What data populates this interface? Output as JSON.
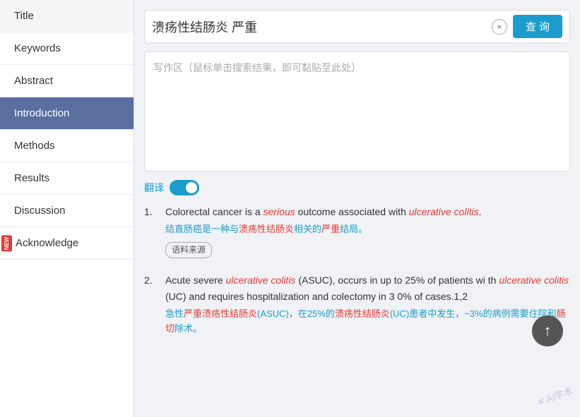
{
  "sidebar": {
    "items": [
      {
        "label": "Title",
        "active": false,
        "new": false
      },
      {
        "label": "Keywords",
        "active": false,
        "new": false
      },
      {
        "label": "Abstract",
        "active": false,
        "new": false
      },
      {
        "label": "Introduction",
        "active": true,
        "new": false
      },
      {
        "label": "Methods",
        "active": false,
        "new": false
      },
      {
        "label": "Results",
        "active": false,
        "new": false
      },
      {
        "label": "Discussion",
        "active": false,
        "new": false
      },
      {
        "label": "Acknowledge",
        "active": false,
        "new": true
      }
    ]
  },
  "search": {
    "value": "溃疡性结肠炎 严重",
    "button_label": "查 询",
    "clear_icon": "×"
  },
  "writing_area": {
    "placeholder": "写作区（鼠标单击搜索结果，即可黏贴至此处）"
  },
  "translate": {
    "label": "翻译"
  },
  "results": [
    {
      "number": "1.",
      "en_text_parts": [
        {
          "text": "Colorectal cancer is a ",
          "type": "normal"
        },
        {
          "text": "serious",
          "type": "italic-red"
        },
        {
          "text": " outcome associated with ",
          "type": "normal"
        },
        {
          "text": "ulcerative colitis",
          "type": "italic-red"
        },
        {
          "text": ".",
          "type": "normal"
        }
      ],
      "en_text": "Colorectal cancer is a serious outcome associated with ulcerative colitis.",
      "cn_text": "结直肠癌是一种与溃疡性结肠炎相关的严重结局。",
      "source_label": "语料来源"
    },
    {
      "number": "2.",
      "en_text": "Acute severe ulcerative colitis (ASUC), occurs in up to 25% of patients with ulcerative colitis (UC) and requires hospitalization and colectomy in 30% of cases.1,2",
      "cn_text": "急性严重溃疡性结肠炎(ASUC)，在25%的溃疡性结肠炎(UC)患者中发生，~3%的病例需要住院和肠切除术。",
      "source_label": ""
    }
  ],
  "watermark": "✕ AI学术",
  "scroll_up": "↑"
}
